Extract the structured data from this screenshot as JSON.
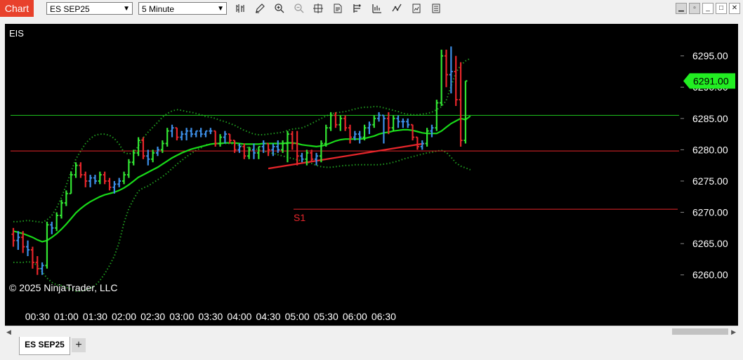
{
  "toolbar": {
    "chart_label": "Chart",
    "instrument": "ES SEP25",
    "interval": "5 Minute",
    "tools": [
      "bar-type-icon",
      "pencil-icon",
      "zoom-in-icon",
      "zoom-out-icon",
      "crosshair-icon",
      "data-box-icon",
      "properties-icon",
      "strategies-icon",
      "indicators-icon",
      "chart-trader-icon",
      "snapshot-icon"
    ]
  },
  "window": {
    "min_icon": "minimize-icon",
    "max_icon": "maximize-icon",
    "close_icon": "close-icon"
  },
  "chart": {
    "instrument_label": "EIS",
    "copyright": "© 2025 NinjaTrader, LLC",
    "s1_label": "S1",
    "last_price_label": "6291.00",
    "colors": {
      "up": "#33e633",
      "down": "#e8262b",
      "neutral": "#3d8fe8",
      "ma": "#19d919",
      "band": "#1f9a1f",
      "pivot": "#e8262b",
      "last_price": "#22ee22"
    }
  },
  "chart_data": {
    "type": "candlestick",
    "title": "",
    "instrument": "EIS",
    "x_ticks": [
      "00:30",
      "01:00",
      "01:30",
      "02:00",
      "02:30",
      "03:00",
      "03:30",
      "04:00",
      "04:30",
      "05:00",
      "05:30",
      "06:00",
      "06:30"
    ],
    "y_ticks": [
      "6260.00",
      "6265.00",
      "6270.00",
      "6275.00",
      "6280.00",
      "6285.00",
      "6290.00",
      "6295.00"
    ],
    "ylim": [
      6257.5,
      6299
    ],
    "time_start": "00:05",
    "bar_interval_min": 5,
    "bars": [
      [
        6266.5,
        6267.5,
        6264.5,
        6265.5
      ],
      [
        6265.5,
        6267,
        6264,
        6266
      ],
      [
        6266,
        6267,
        6263.5,
        6264.5
      ],
      [
        6264.5,
        6265.5,
        6263,
        6264
      ],
      [
        6264,
        6264.5,
        6261,
        6262
      ],
      [
        6262,
        6263,
        6260,
        6261
      ],
      [
        6261,
        6262,
        6260,
        6261.5
      ],
      [
        6261.5,
        6268.5,
        6261,
        6268
      ],
      [
        6268,
        6268.5,
        6266.5,
        6267.5
      ],
      [
        6267.5,
        6270,
        6267,
        6269.5
      ],
      [
        6269.5,
        6272,
        6269,
        6271.5
      ],
      [
        6271.5,
        6273.5,
        6271,
        6273
      ],
      [
        6273,
        6276.5,
        6273,
        6276
      ],
      [
        6276,
        6278,
        6275.5,
        6277.5
      ],
      [
        6277.5,
        6278,
        6275.5,
        6276
      ],
      [
        6276,
        6276.5,
        6274,
        6275
      ],
      [
        6275,
        6276,
        6274,
        6275.5
      ],
      [
        6275.5,
        6276,
        6274.5,
        6275
      ],
      [
        6275,
        6276.5,
        6274.5,
        6276
      ],
      [
        6276,
        6276.5,
        6274.5,
        6275
      ],
      [
        6275,
        6275.5,
        6273.5,
        6274
      ],
      [
        6274,
        6275,
        6273,
        6274.5
      ],
      [
        6274.5,
        6275.5,
        6274,
        6275
      ],
      [
        6275,
        6276.5,
        6274.5,
        6276
      ],
      [
        6276,
        6278.5,
        6275.5,
        6278
      ],
      [
        6278,
        6280,
        6277.5,
        6279.5
      ],
      [
        6279.5,
        6282,
        6279,
        6281.5
      ],
      [
        6281.5,
        6282,
        6278.5,
        6279
      ],
      [
        6279,
        6280,
        6277.5,
        6278.5
      ],
      [
        6278.5,
        6280,
        6278,
        6279.5
      ],
      [
        6279.5,
        6280.5,
        6279,
        6280
      ],
      [
        6280,
        6281.5,
        6279.5,
        6281
      ],
      [
        6281,
        6283.5,
        6280.5,
        6283
      ],
      [
        6283,
        6284,
        6282,
        6283.5
      ],
      [
        6283.5,
        6283.5,
        6281.5,
        6282
      ],
      [
        6282,
        6283,
        6281.5,
        6282.5
      ],
      [
        6282.5,
        6283.5,
        6281.5,
        6283
      ],
      [
        6283,
        6283.5,
        6282,
        6282.5
      ],
      [
        6282.5,
        6283,
        6282,
        6283
      ],
      [
        6283,
        6283.5,
        6282,
        6282.5
      ],
      [
        6282.5,
        6283,
        6282,
        6283
      ],
      [
        6283,
        6283.5,
        6282.5,
        6283
      ],
      [
        6283,
        6283,
        6280.5,
        6281
      ],
      [
        6281,
        6282.5,
        6280.5,
        6282
      ],
      [
        6282,
        6283,
        6281,
        6282.5
      ],
      [
        6282.5,
        6282.5,
        6281,
        6281.5
      ],
      [
        6281.5,
        6281.5,
        6279.5,
        6280
      ],
      [
        6280,
        6281,
        6279.5,
        6280.5
      ],
      [
        6280.5,
        6281,
        6278.5,
        6279
      ],
      [
        6279,
        6280.5,
        6278.5,
        6280
      ],
      [
        6280,
        6281,
        6278.5,
        6279.5
      ],
      [
        6279.5,
        6280.5,
        6278.5,
        6280.5
      ],
      [
        6280.5,
        6281.5,
        6279.5,
        6281
      ],
      [
        6281,
        6281,
        6279,
        6280
      ],
      [
        6280,
        6281,
        6279,
        6280.5
      ],
      [
        6280.5,
        6281.5,
        6279.5,
        6280
      ],
      [
        6280,
        6281.5,
        6279.5,
        6281
      ],
      [
        6281,
        6283,
        6278,
        6282.5
      ],
      [
        6282.5,
        6283,
        6280,
        6281
      ],
      [
        6281,
        6283,
        6277.5,
        6279
      ],
      [
        6279,
        6279.5,
        6278,
        6278.5
      ],
      [
        6278.5,
        6280,
        6277.5,
        6279.5
      ],
      [
        6279.5,
        6280,
        6278,
        6278.5
      ],
      [
        6278.5,
        6279.5,
        6277.5,
        6279
      ],
      [
        6279,
        6281.5,
        6278,
        6281
      ],
      [
        6281,
        6284,
        6280.5,
        6283.5
      ],
      [
        6283.5,
        6286,
        6283,
        6285.5
      ],
      [
        6285.5,
        6286,
        6283.5,
        6284
      ],
      [
        6284,
        6285.5,
        6283,
        6285
      ],
      [
        6285,
        6285.5,
        6283,
        6283.5
      ],
      [
        6283.5,
        6284,
        6281,
        6282
      ],
      [
        6282,
        6283,
        6281.5,
        6282.5
      ],
      [
        6282.5,
        6283,
        6281,
        6282
      ],
      [
        6282,
        6284,
        6281.5,
        6283.5
      ],
      [
        6283.5,
        6284.5,
        6282.5,
        6284
      ],
      [
        6284,
        6285.5,
        6283.5,
        6285
      ],
      [
        6285,
        6286,
        6284.5,
        6285.5
      ],
      [
        6285.5,
        6285.5,
        6281,
        6285
      ],
      [
        6285,
        6286,
        6282.5,
        6283.5
      ],
      [
        6283.5,
        6285.5,
        6283,
        6285
      ],
      [
        6285,
        6285.5,
        6283.5,
        6284.5
      ],
      [
        6284.5,
        6285,
        6283.5,
        6284.5
      ],
      [
        6284.5,
        6285,
        6283.5,
        6284
      ],
      [
        6284,
        6284,
        6281.5,
        6282
      ],
      [
        6282,
        6282,
        6280,
        6280.5
      ],
      [
        6280.5,
        6281.5,
        6280,
        6281
      ],
      [
        6281,
        6283.5,
        6280.5,
        6283
      ],
      [
        6283,
        6284,
        6282,
        6283.5
      ],
      [
        6283.5,
        6288,
        6283,
        6287.5
      ],
      [
        6287.5,
        6296,
        6287,
        6295
      ],
      [
        6295,
        6296,
        6290,
        6292
      ],
      [
        6292,
        6296.5,
        6289,
        6292.5
      ],
      [
        6292.5,
        6295,
        6287,
        6288
      ],
      [
        6288,
        6294,
        6280.5,
        6281.5
      ],
      [
        6281.5,
        6291,
        6281,
        6291
      ]
    ],
    "moving_average": [
      6267,
      6266.8,
      6266.6,
      6266.3,
      6266,
      6265.6,
      6265.3,
      6265.5,
      6266,
      6266.6,
      6267.3,
      6268.1,
      6269,
      6269.9,
      6270.6,
      6271.2,
      6271.7,
      6272.1,
      6272.5,
      6272.8,
      6273,
      6273.2,
      6273.5,
      6273.9,
      6274.4,
      6275,
      6275.6,
      6276,
      6276.4,
      6276.8,
      6277.2,
      6277.7,
      6278.2,
      6278.7,
      6279.1,
      6279.5,
      6279.8,
      6280.1,
      6280.3,
      6280.5,
      6280.7,
      6280.9,
      6281,
      6281,
      6281.1,
      6281.1,
      6281.1,
      6281,
      6280.9,
      6280.9,
      6280.9,
      6280.9,
      6281,
      6281,
      6281,
      6281,
      6281,
      6281.1,
      6281.1,
      6281,
      6280.8,
      6280.7,
      6280.6,
      6280.5,
      6280.6,
      6280.8,
      6281.1,
      6281.4,
      6281.6,
      6281.7,
      6281.7,
      6281.7,
      6281.7,
      6281.8,
      6282,
      6282.2,
      6282.5,
      6282.7,
      6282.8,
      6283,
      6283.1,
      6283.2,
      6283.2,
      6283.1,
      6282.9,
      6282.7,
      6282.6,
      6282.6,
      6282.6,
      6283,
      6283.6,
      6284.2,
      6284.6,
      6285,
      6284.8,
      6285.4
    ],
    "upper_band": [
      6268.5,
      6268.5,
      6268.6,
      6268.7,
      6268.6,
      6268.5,
      6268.4,
      6268.8,
      6269.5,
      6270.7,
      6272.4,
      6274.3,
      6276.5,
      6278.5,
      6279.8,
      6281,
      6281.8,
      6282.3,
      6282.5,
      6282.5,
      6282.3,
      6281.8,
      6280.9,
      6279.6,
      6279.3,
      6279.6,
      6280.6,
      6281.9,
      6282.8,
      6283.6,
      6284.4,
      6285.2,
      6285.8,
      6286.2,
      6286.4,
      6286.3,
      6286.1,
      6286,
      6285.8,
      6285.6,
      6285.3,
      6285.2,
      6285,
      6284.7,
      6284.5,
      6284.2,
      6283.9,
      6283.5,
      6283.1,
      6282.8,
      6282.5,
      6282.4,
      6282.4,
      6282.5,
      6282.6,
      6282.7,
      6282.8,
      6283.1,
      6283.3,
      6283.4,
      6283.5,
      6283.8,
      6284.2,
      6284.6,
      6285,
      6285.4,
      6285.7,
      6285.9,
      6286,
      6286.1,
      6286.3,
      6286.5,
      6286.7,
      6286.8,
      6286.8,
      6286.9,
      6286.9,
      6286.7,
      6286.5,
      6286.3,
      6286.1,
      6285.8,
      6285.7,
      6285.6,
      6285.6,
      6285.7,
      6285.8,
      6286,
      6286.4,
      6286.9,
      6287.9,
      6290.2,
      6292.3,
      6293.5,
      6294.2,
      6294.6
    ],
    "lower_band": [
      6262,
      6262,
      6262,
      6262.1,
      6262,
      6261.5,
      6260.5,
      6259.5,
      6258.8,
      6258.4,
      6258.3,
      6258,
      6257.7,
      6257.4,
      6257.4,
      6257.6,
      6257.9,
      6258.3,
      6259.1,
      6260.2,
      6261.5,
      6263,
      6265.2,
      6268.3,
      6270.6,
      6272.1,
      6273.4,
      6273.9,
      6274.2,
      6274.7,
      6275.2,
      6275.7,
      6276.3,
      6277,
      6277.7,
      6278.3,
      6278.9,
      6279.4,
      6279.9,
      6280.3,
      6280.8,
      6280.9,
      6281,
      6281,
      6281,
      6281,
      6280.9,
      6280.7,
      6280.5,
      6280.3,
      6280.2,
      6280,
      6279.8,
      6279.6,
      6279.4,
      6279.2,
      6279,
      6278.8,
      6278.6,
      6278.4,
      6278.2,
      6278,
      6277.8,
      6277.5,
      6277.3,
      6277.2,
      6277.2,
      6277.3,
      6277.4,
      6277.5,
      6277.5,
      6277.6,
      6277.6,
      6277.6,
      6277.6,
      6277.6,
      6277.6,
      6277.7,
      6277.8,
      6278,
      6278.2,
      6278.5,
      6278.7,
      6278.9,
      6279.1,
      6279.3,
      6279.5,
      6279.6,
      6279.8,
      6279.9,
      6279.6,
      6278.8,
      6277.9,
      6277.4,
      6277.1,
      6276.8
    ],
    "horizontal_lines": [
      {
        "price": 6285.5,
        "color": "green"
      },
      {
        "price": 6279.8,
        "color": "red"
      },
      {
        "price": 6270.5,
        "color": "red",
        "label": "S1",
        "from": "05:05"
      }
    ],
    "trendline": {
      "from_time": "04:30",
      "from_price": 6277,
      "to_time": "06:50",
      "to_price": 6281
    },
    "last_price": 6291
  }
}
